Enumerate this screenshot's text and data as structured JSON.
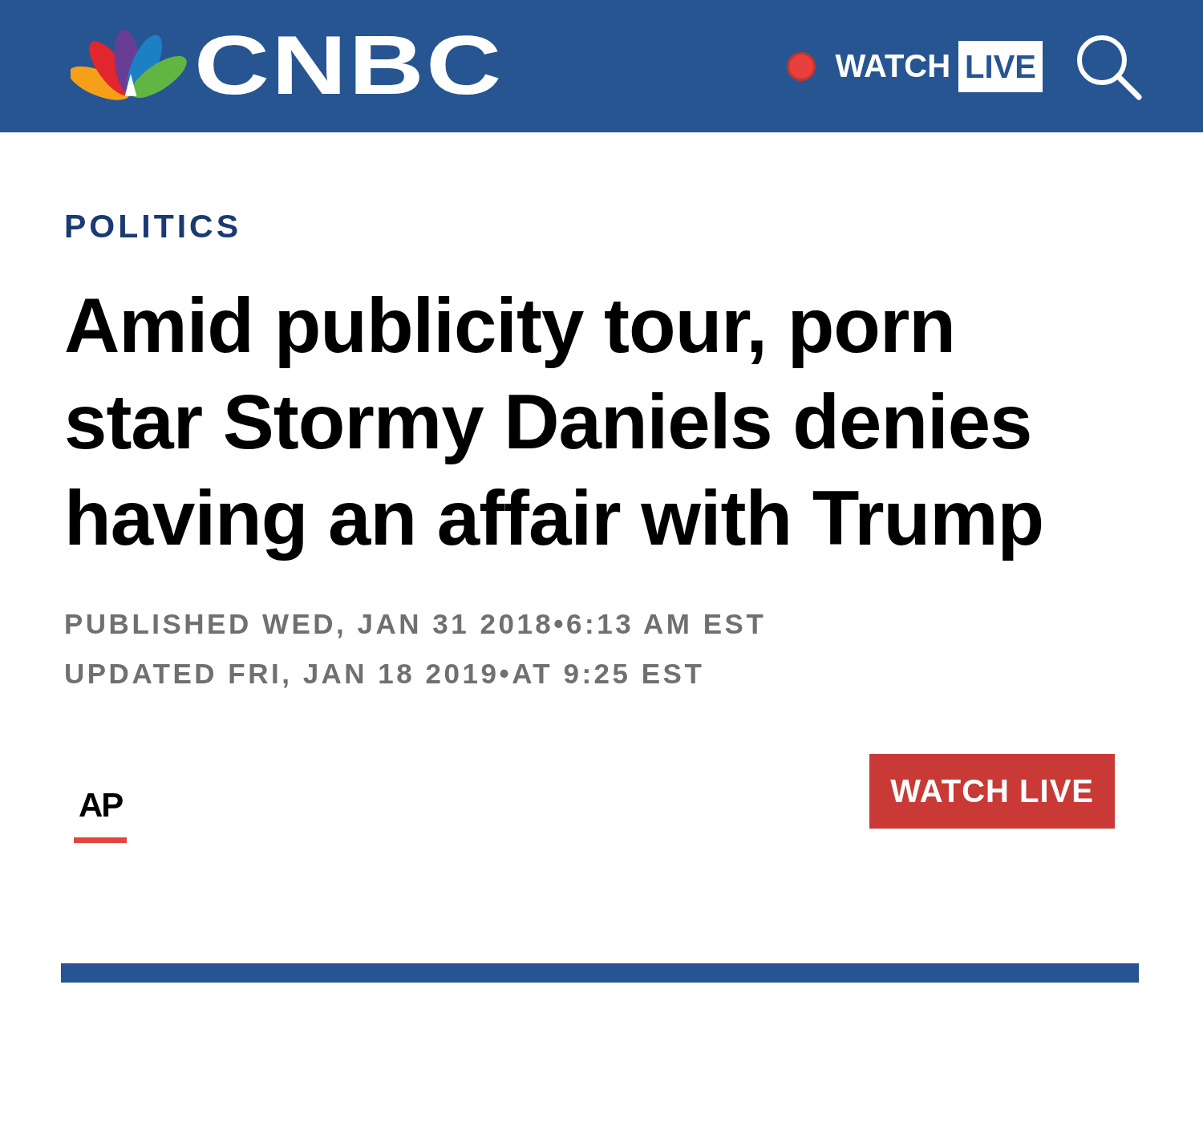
{
  "header": {
    "logo": "CNBC",
    "watch_live": {
      "label": "WATCH",
      "badge": "LIVE",
      "live": true
    }
  },
  "article": {
    "section": "POLITICS",
    "headline": "Amid publicity tour, porn star Stormy Daniels denies having an affair with Trump",
    "published": "PUBLISHED WED, JAN 31 2018•6:13 AM EST",
    "updated": "UPDATED FRI, JAN 18 2019•AT 9:25 EST",
    "author": "AP",
    "watch_live_button": "WATCH LIVE"
  }
}
